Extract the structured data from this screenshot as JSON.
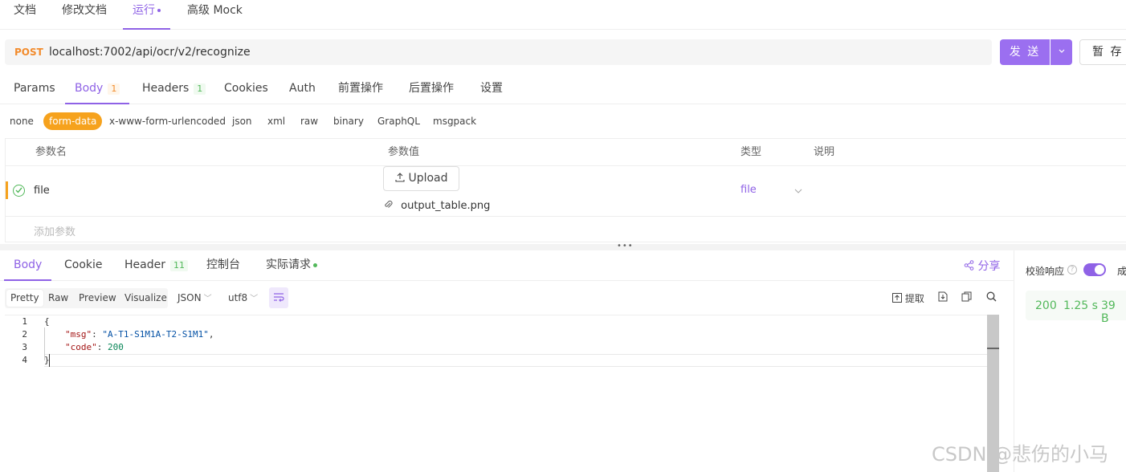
{
  "top_tabs": {
    "doc": "文档",
    "edit_doc": "修改文档",
    "run": "运行",
    "mock": "高级 Mock"
  },
  "request": {
    "method": "POST",
    "url": "localhost:7002/api/ocr/v2/recognize",
    "send_label": "发 送",
    "save_label": "暂 存"
  },
  "request_tabs": {
    "params": "Params",
    "body": "Body",
    "body_count": "1",
    "headers": "Headers",
    "headers_count": "1",
    "cookies": "Cookies",
    "auth": "Auth",
    "pre_ops": "前置操作",
    "post_ops": "后置操作",
    "settings": "设置"
  },
  "body_types": {
    "none": "none",
    "form_data": "form-data",
    "urlencoded": "x-www-form-urlencoded",
    "json": "json",
    "xml": "xml",
    "raw": "raw",
    "binary": "binary",
    "graphql": "GraphQL",
    "msgpack": "msgpack",
    "selected": "form-data"
  },
  "params_table": {
    "headers": {
      "name": "参数名",
      "value": "参数值",
      "type": "类型",
      "desc": "说明"
    },
    "rows": [
      {
        "enabled": true,
        "name": "file",
        "upload_label": "Upload",
        "file_name": "output_table.png",
        "type": "file"
      }
    ],
    "add_placeholder": "添加参数"
  },
  "response_tabs": {
    "body": "Body",
    "cookie": "Cookie",
    "header": "Header",
    "header_count": "11",
    "console": "控制台",
    "actual_request": "实际请求"
  },
  "share_label": "分享",
  "view_toolbar": {
    "pretty": "Pretty",
    "raw": "Raw",
    "preview": "Preview",
    "visualize": "Visualize",
    "format": "JSON",
    "encoding": "utf8",
    "extract": "提取"
  },
  "code_lines": {
    "l1": "1",
    "l2": "2",
    "l3": "3",
    "l4": "4",
    "open_brace": "{",
    "msg_key": "\"msg\"",
    "msg_value": "\"A-T1-S1M1A-T2-S1M1\"",
    "code_key": "\"code\"",
    "code_value": "200",
    "close_brace": "}"
  },
  "response_meta": {
    "validate_label": "校验响应",
    "validate_enabled": true,
    "success_label": "成",
    "status": "200",
    "time": "1.25 s",
    "size": "39 B"
  },
  "watermark": "CSDN @悲伤的小马"
}
